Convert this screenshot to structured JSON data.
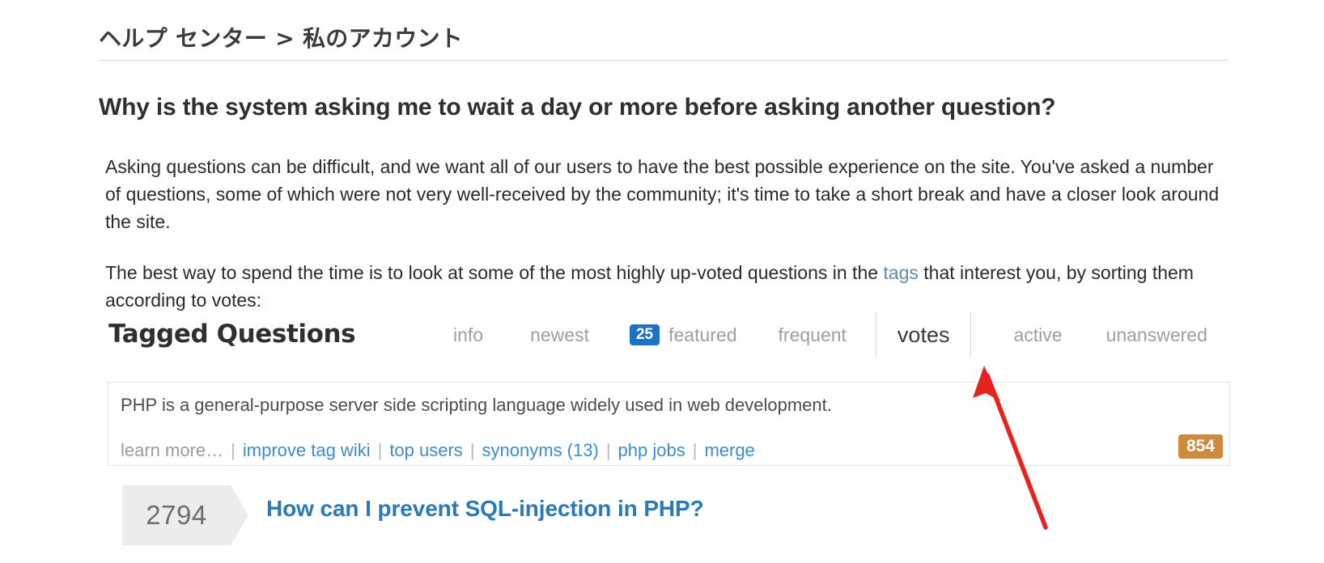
{
  "breadcrumb": {
    "text": "ヘルプ センター > 私のアカウント"
  },
  "article": {
    "title": "Why is the system asking me to wait a day or more before asking another question?",
    "paragraph_1": "Asking questions can be difficult, and we want all of our users to have the best possible experience on the site. You've asked a number of questions, some of which were not very well-received by the community; it's time to take a short break and have a closer look around the site.",
    "paragraph_2_before": "The best way to spend the time is to look at some of the most highly up-voted questions in the ",
    "paragraph_2_link": "tags",
    "paragraph_2_after": " that interest you, by sorting them according to votes:"
  },
  "embedded_screenshot": {
    "header_title": "Tagged Questions",
    "tabs": [
      {
        "label": "info",
        "active": false,
        "badge": null
      },
      {
        "label": "newest",
        "active": false,
        "badge": null
      },
      {
        "label": "featured",
        "active": false,
        "badge": "25"
      },
      {
        "label": "frequent",
        "active": false,
        "badge": null
      },
      {
        "label": "votes",
        "active": true,
        "badge": null
      },
      {
        "label": "active",
        "active": false,
        "badge": null
      },
      {
        "label": "unanswered",
        "active": false,
        "badge": null
      }
    ],
    "featured_badge": "25",
    "active_tab_label": "votes",
    "tag_wiki": {
      "description": "PHP is a general-purpose server side scripting language widely used in web development.",
      "links": [
        {
          "label": "learn more…",
          "type": "muted"
        },
        {
          "label": "improve tag wiki",
          "type": "link"
        },
        {
          "label": "top users",
          "type": "link"
        },
        {
          "label": "synonyms (13)",
          "type": "link"
        },
        {
          "label": "php jobs",
          "type": "link"
        },
        {
          "label": "merge",
          "type": "link"
        }
      ],
      "separator": "|",
      "tag_score": "854"
    },
    "question": {
      "votes": "2794",
      "title": "How can I prevent SQL-injection in PHP?"
    }
  },
  "annotation": {
    "arrow_color": "#e8221c",
    "points_to": "votes"
  },
  "colors": {
    "link_blue": "#3f8bd0",
    "inline_link_blue": "#5f8cad",
    "badge_blue": "#1d72c4",
    "tag_score_orange": "#cf8a3e",
    "question_title_blue": "#2a7ab8",
    "muted_gray": "#9aa0a6",
    "annotation_red": "#e8221c"
  }
}
